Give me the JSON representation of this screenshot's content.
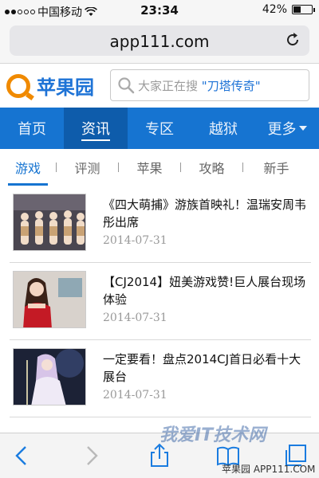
{
  "status": {
    "carrier": "中国移动",
    "time": "23:34",
    "battery": "42%",
    "battery_level": 0.42
  },
  "browser": {
    "url": "app111.com"
  },
  "site": {
    "logo_text": "苹果园",
    "search_placeholder_prefix": "大家正在搜",
    "search_placeholder_highlight": "\"刀塔传奇\""
  },
  "nav": {
    "items": [
      "首页",
      "资讯",
      "专区",
      "越狱",
      "更多"
    ],
    "active_index": 1
  },
  "subtabs": {
    "items": [
      "游戏",
      "评测",
      "苹果",
      "攻略",
      "新手"
    ],
    "active_index": 0
  },
  "news": [
    {
      "title": "《四大萌捕》游族首映礼！温瑞安周韦彤出席",
      "date": "2014-07-31"
    },
    {
      "title": "【CJ2014】妞美游戏赞!巨人展台现场体验",
      "date": "2014-07-31"
    },
    {
      "title": "一定要看！盘点2014CJ首日必看十大展台",
      "date": "2014-07-31"
    }
  ],
  "watermark": {
    "main": "我爱IT技术网",
    "sub": "苹果园 APP111.COM"
  },
  "icons": {
    "back": "back-arrow-icon",
    "forward": "forward-arrow-icon",
    "share": "share-icon",
    "bookmarks": "bookmarks-icon",
    "tabs": "tabs-icon",
    "reload": "reload-icon",
    "search": "search-icon",
    "logo": "logo-icon"
  },
  "colors": {
    "brand_blue": "#1674d1",
    "logo_orange": "#f08a00"
  }
}
